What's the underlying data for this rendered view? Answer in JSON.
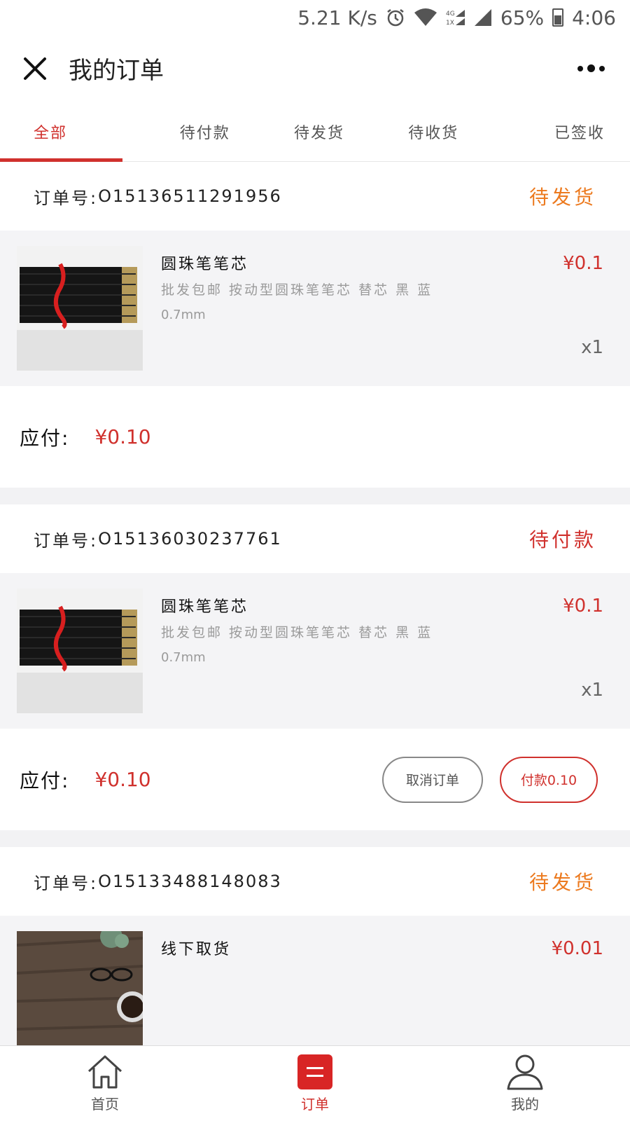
{
  "status_bar": {
    "speed": "5.21 K/s",
    "battery": "65%",
    "time": "4:06"
  },
  "header": {
    "title": "我的订单"
  },
  "tabs": [
    {
      "label": "全部",
      "active": true
    },
    {
      "label": "待付款",
      "active": false
    },
    {
      "label": "待发货",
      "active": false
    },
    {
      "label": "待收货",
      "active": false
    },
    {
      "label": "已签收",
      "active": false
    }
  ],
  "order_no_label": "订单号:",
  "pay_label": "应付:",
  "orders": [
    {
      "order_no": "O15136511291956",
      "status": "待发货",
      "item": {
        "name": "圆珠笔笔芯",
        "desc": "批发包邮 按动型圆珠笔笔芯 替芯 黑 蓝",
        "spec": "0.7mm",
        "price": "¥0.1",
        "qty": "x1"
      },
      "total": "¥0.10"
    },
    {
      "order_no": "O15136030237761",
      "status": "待付款",
      "item": {
        "name": "圆珠笔笔芯",
        "desc": "批发包邮 按动型圆珠笔笔芯 替芯 黑 蓝",
        "spec": "0.7mm",
        "price": "¥0.1",
        "qty": "x1"
      },
      "total": "¥0.10",
      "cancel_label": "取消订单",
      "pay_button_label": "付款0.10"
    },
    {
      "order_no": "O15133488148083",
      "status": "待发货",
      "item": {
        "name": "线下取货",
        "price": "¥0.01"
      }
    }
  ],
  "bottom_nav": [
    {
      "label": "首页",
      "icon": "home-icon",
      "active": false
    },
    {
      "label": "订单",
      "icon": "order-icon",
      "active": true
    },
    {
      "label": "我的",
      "icon": "user-icon",
      "active": false
    }
  ],
  "colors": {
    "accent_red": "#d0312d",
    "status_orange": "#ec7a1f",
    "item_bg": "#f4f4f6"
  }
}
